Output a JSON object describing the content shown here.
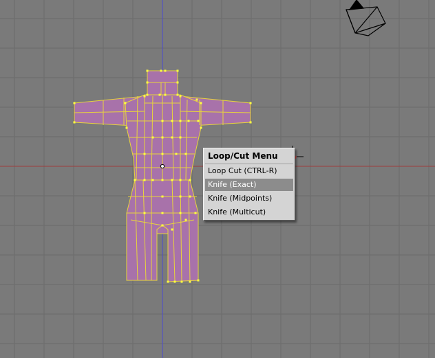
{
  "menu": {
    "title": "Loop/Cut Menu",
    "items": [
      {
        "label": "Loop Cut (CTRL-R)",
        "active": false
      },
      {
        "label": "Knife (Exact)",
        "active": true
      },
      {
        "label": "Knife (Midpoints)",
        "active": false
      },
      {
        "label": "Knife (Multicut)",
        "active": false
      }
    ]
  },
  "colors": {
    "background": "#7a7a7a",
    "grid": "#6b6b6b",
    "x_axis": "#a03c3c",
    "y_axis": "#4a4ad0",
    "mesh_fill": "#a872aa",
    "mesh_edge": "#e8d43c",
    "vertex": "#ffff40",
    "menu_bg": "#d4d4d4",
    "menu_highlight": "#8c8c8c"
  },
  "icons": {
    "camera": "camera-icon",
    "cursor": "3d-cursor-icon",
    "pivot": "object-center-icon"
  }
}
